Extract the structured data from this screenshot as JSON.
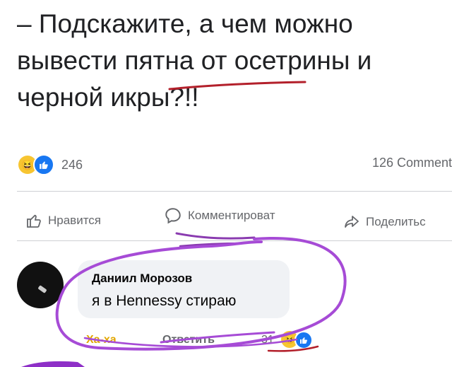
{
  "post": {
    "text": "– Подскажите, а чем можно вывести пятна от осетрины и черной икры?!!"
  },
  "stats": {
    "reaction_count": "246",
    "comment_count": "126 Comment"
  },
  "actions": {
    "like_label": "Нравится",
    "comment_label": "Комментироват",
    "share_label": "Поделитьс"
  },
  "comment": {
    "author": "Даниил Морозов",
    "text": "я в Hennessy стираю",
    "haha_label": "Ха-ха",
    "reply_label": "Ответить",
    "reaction_count": "31"
  },
  "colors": {
    "like_blue": "#1877f2",
    "haha_yellow": "#f7c531",
    "scribble_purple": "#a64bd6",
    "scribble_red": "#b3202b"
  },
  "icons": [
    "haha-emoji-icon",
    "like-thumb-icon",
    "thumbs-up-icon",
    "comment-bubble-icon",
    "share-arrow-icon"
  ]
}
